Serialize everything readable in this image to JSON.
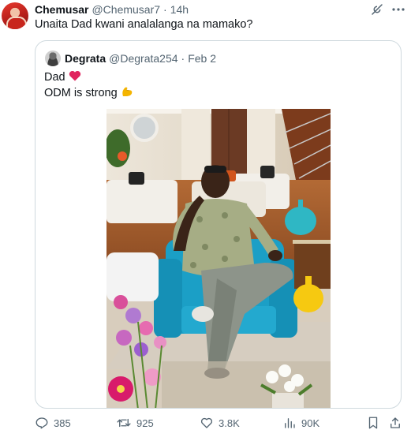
{
  "tweet": {
    "display_name": "Chemusar",
    "handle": "@Chemusar7",
    "separator": "·",
    "time": "14h",
    "text": "Unaita Dad kwani analalanga na mamako?"
  },
  "quote": {
    "display_name": "Degrata",
    "handle": "@Degrata254",
    "separator": "·",
    "date": "Feb 2",
    "line1": "Dad",
    "line1_emoji": "red-heart",
    "line2": "ODM is strong",
    "line2_emoji": "flexed-biceps"
  },
  "actions": {
    "replies": "385",
    "reposts": "925",
    "likes": "3.8K",
    "views": "90K"
  },
  "colors": {
    "text_primary": "#0f1419",
    "text_secondary": "#536471",
    "border": "#cfd9de",
    "heart": "#e0245e",
    "bicep": "#f4b400"
  },
  "icons": [
    "grok-icon",
    "more-icon",
    "reply-icon",
    "repost-icon",
    "like-icon",
    "views-icon",
    "bookmark-icon",
    "share-icon"
  ]
}
